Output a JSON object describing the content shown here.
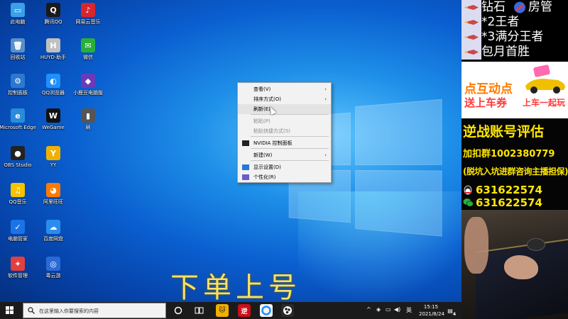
{
  "desktop": {
    "icons": [
      {
        "label": "此电脑",
        "glyph": "▭",
        "color": "#3aa0e8"
      },
      {
        "label": "腾讯QQ",
        "glyph": "Q",
        "color": "#1a1a1a"
      },
      {
        "label": "网易云音乐",
        "glyph": "♪",
        "color": "#d8262e"
      },
      {
        "label": "回收站",
        "glyph": "🗑",
        "color": "#5a8fc8"
      },
      {
        "label": "HUYD·助手",
        "glyph": "H",
        "color": "#c0c0c0"
      },
      {
        "label": "微信",
        "glyph": "✉",
        "color": "#2aae3a"
      },
      {
        "label": "控制面板",
        "glyph": "⚙",
        "color": "#2b78d0"
      },
      {
        "label": "QQ浏览器",
        "glyph": "◐",
        "color": "#1e90ff"
      },
      {
        "label": "小鹿豆电脑版",
        "glyph": "◆",
        "color": "#6a3ab8"
      },
      {
        "label": "Microsoft Edge",
        "glyph": "e",
        "color": "#2a8bd8"
      },
      {
        "label": "WeGame",
        "glyph": "W",
        "color": "#111111"
      },
      {
        "label": "刷",
        "glyph": "▮",
        "color": "#555555"
      },
      {
        "label": "OBS Studio",
        "glyph": "●",
        "color": "#222222"
      },
      {
        "label": "YY",
        "glyph": "Y",
        "color": "#f0b000"
      },
      {
        "label": "QQ音乐",
        "glyph": "♫",
        "color": "#f6c300"
      },
      {
        "label": "阿里旺旺",
        "glyph": "◕",
        "color": "#ff7a00"
      },
      {
        "label": "电脑管家",
        "glyph": "✓",
        "color": "#1a74e8"
      },
      {
        "label": "百度网盘",
        "glyph": "☁",
        "color": "#2b8cf0"
      },
      {
        "label": "软件管理",
        "glyph": "✦",
        "color": "#e04040"
      },
      {
        "label": "毒云游",
        "glyph": "◎",
        "color": "#2a6ad8"
      }
    ]
  },
  "context_menu": {
    "items": [
      {
        "label": "查看(V)",
        "disabled": false,
        "submenu": true,
        "icon": ""
      },
      {
        "label": "排序方式(O)",
        "disabled": false,
        "submenu": true,
        "icon": ""
      },
      {
        "label": "刷新(E)",
        "disabled": false,
        "submenu": false,
        "icon": ""
      },
      {
        "label": "粘贴(P)",
        "disabled": true,
        "submenu": false,
        "icon": ""
      },
      {
        "label": "粘贴快捷方式(S)",
        "disabled": true,
        "submenu": false,
        "icon": ""
      },
      {
        "label": "NVIDIA 控制面板",
        "disabled": false,
        "submenu": false,
        "icon": "nvidia-icon"
      },
      {
        "label": "新建(W)",
        "disabled": false,
        "submenu": true,
        "icon": ""
      },
      {
        "label": "显示设置(D)",
        "disabled": false,
        "submenu": false,
        "icon": "display-settings-icon"
      },
      {
        "label": "个性化(R)",
        "disabled": false,
        "submenu": false,
        "icon": "personalize-icon"
      }
    ],
    "submenu_arrow": "›"
  },
  "overlay": {
    "text": "下单上号"
  },
  "taskbar": {
    "search_placeholder": "在这里输入你要搜索的内容",
    "tray_caret": "^",
    "tray_lang": "英",
    "time": "15:15",
    "date": "2021/8/24",
    "notification_count": "4",
    "app_label_ni": "逆"
  },
  "banner": {
    "rows": [
      "钻石",
      "*2王者",
      "*3满分王者",
      "包月首胜"
    ],
    "role_label": "房管",
    "promo_line1": "点互动点",
    "promo_line2a": "送上车券",
    "promo_line2b": "上车一起玩",
    "title": "逆战账号评估",
    "group": "加扣群1002380779",
    "note": "(脱坑入坑进群咨询主播担保)",
    "qq": "631622574",
    "wechat": "631622574"
  },
  "colors": {
    "accent": "#0a5fd0",
    "banner_yellow": "#ffe800",
    "promo_orange": "#ff7a00"
  }
}
